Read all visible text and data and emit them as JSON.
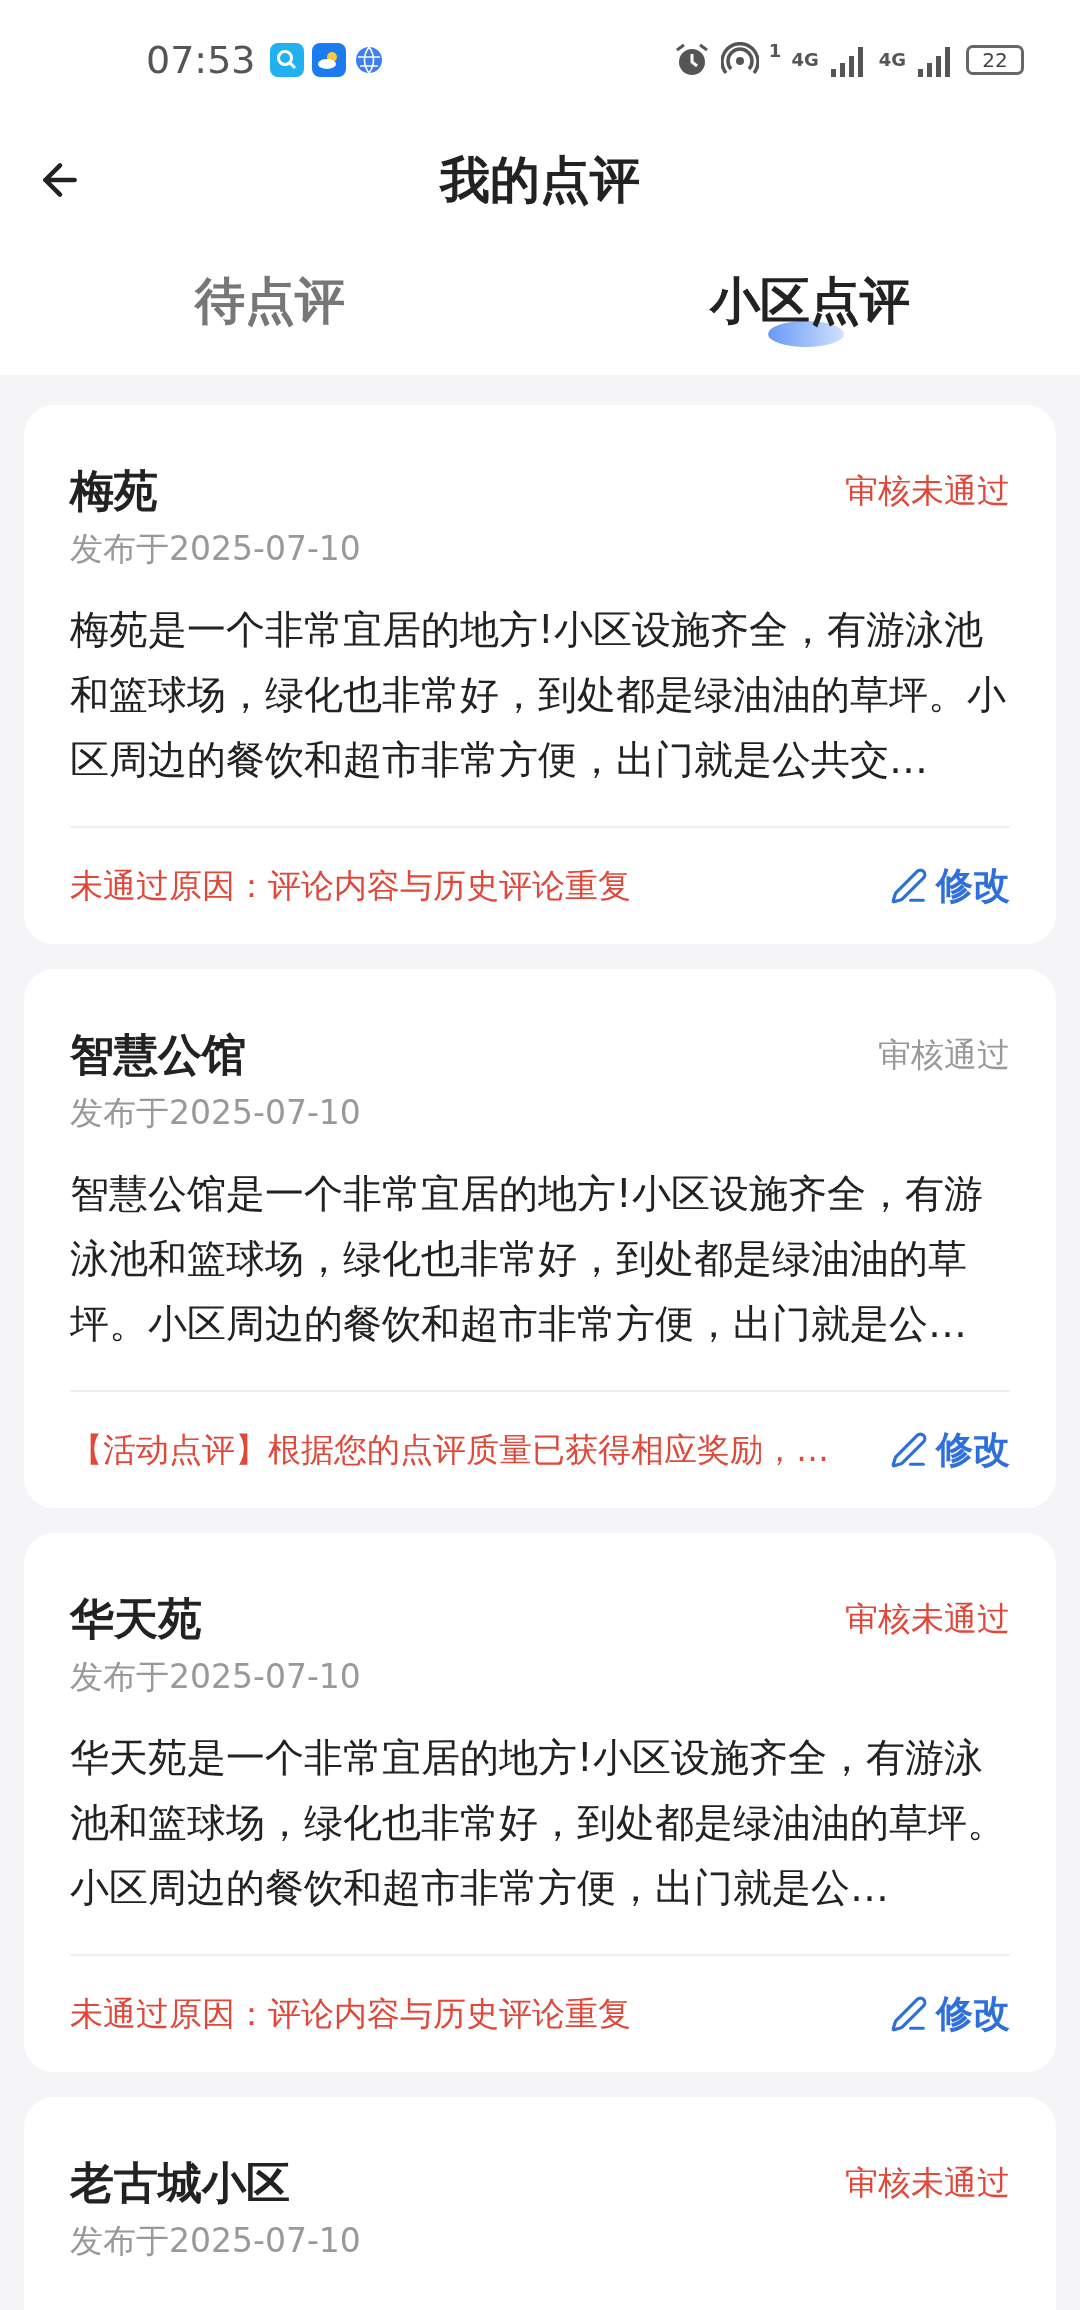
{
  "status_bar": {
    "time": "07:53",
    "sim1_badge": "1",
    "sim1_network": "4G",
    "sim2_network": "4G",
    "battery": "22"
  },
  "header": {
    "title": "我的点评"
  },
  "tabs": [
    {
      "label": "待点评",
      "selected": false
    },
    {
      "label": "小区点评",
      "selected": true
    }
  ],
  "reviews": [
    {
      "title": "梅苑",
      "status": {
        "text": "审核未通过",
        "kind": "rejected"
      },
      "date": "发布于2025-07-10",
      "body": "梅苑是一个非常宜居的地方!小区设施齐全，有游泳池和篮球场，绿化也非常好，到处都是绿油油的草坪。小区周边的餐饮和超市非常方便，出门就是公共交…",
      "note": "未通过原因：评论内容与历史评论重复",
      "edit": "修改"
    },
    {
      "title": "智慧公馆",
      "status": {
        "text": "审核通过",
        "kind": "approved"
      },
      "date": "发布于2025-07-10",
      "body": "智慧公馆是一个非常宜居的地方!小区设施齐全，有游泳池和篮球场，绿化也非常好，到处都是绿油油的草坪。小区周边的餐饮和超市非常方便，出门就是公…",
      "note": "【活动点评】根据您的点评质量已获得相应奖励，…",
      "edit": "修改"
    },
    {
      "title": "华天苑",
      "status": {
        "text": "审核未通过",
        "kind": "rejected"
      },
      "date": "发布于2025-07-10",
      "body": "华天苑是一个非常宜居的地方!小区设施齐全，有游泳池和篮球场，绿化也非常好，到处都是绿油油的草坪。小区周边的餐饮和超市非常方便，出门就是公…",
      "note": "未通过原因：评论内容与历史评论重复",
      "edit": "修改"
    },
    {
      "title": "老古城小区",
      "status": {
        "text": "审核未通过",
        "kind": "rejected"
      },
      "date": "发布于2025-07-10"
    }
  ]
}
